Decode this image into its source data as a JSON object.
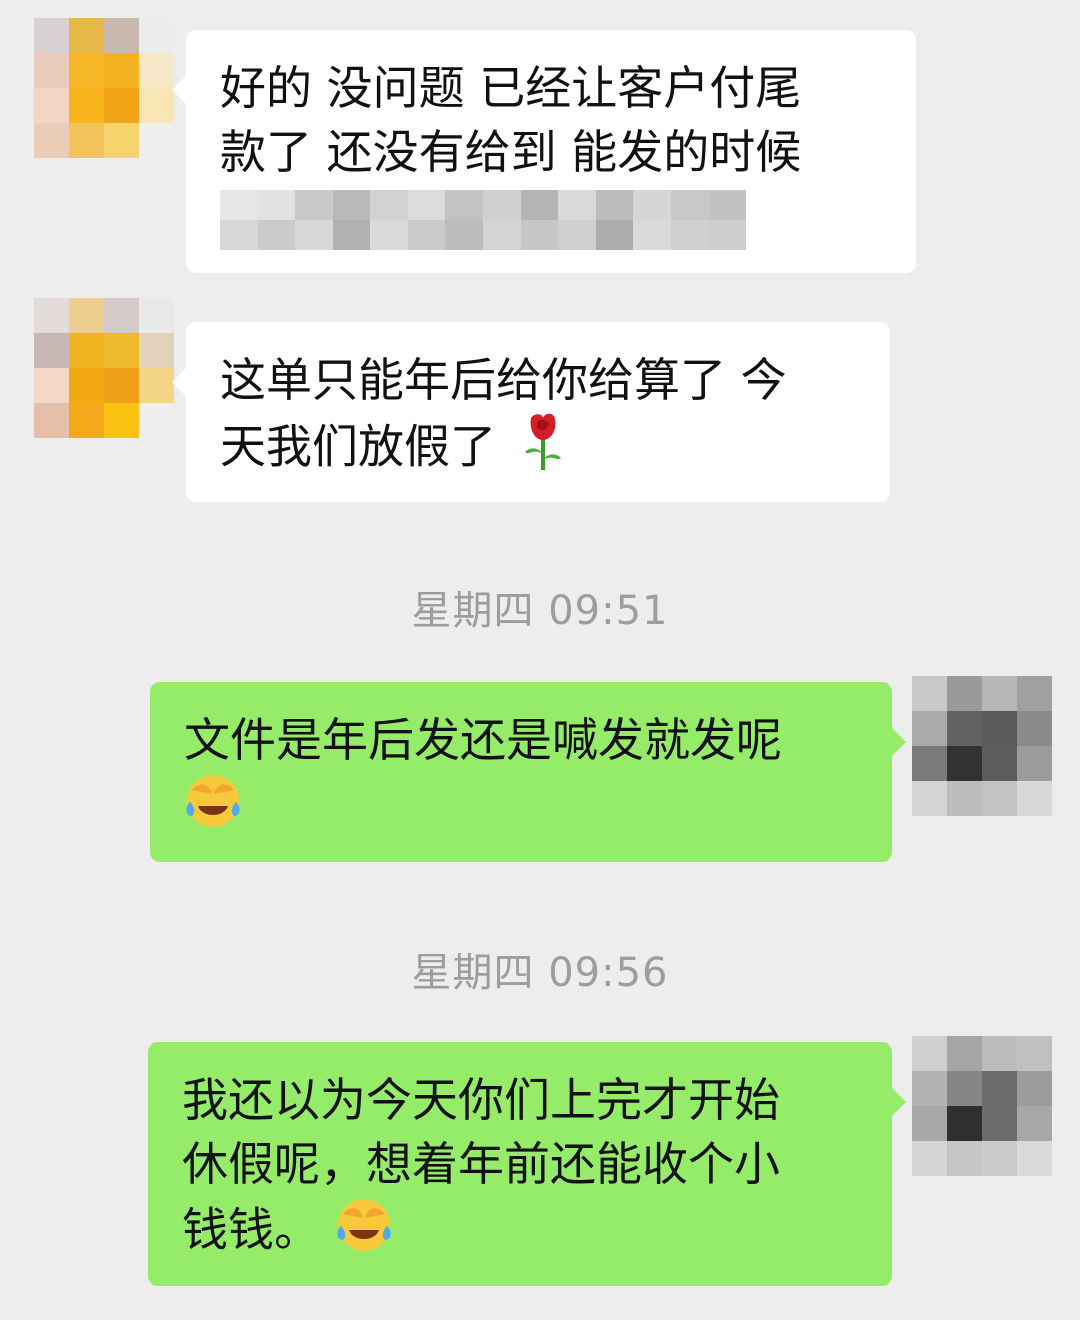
{
  "messages": [
    {
      "side": "in",
      "lines": [
        "好的 没问题  已经让客户付尾",
        "款了 还没有给到 能发的时候"
      ],
      "has_redacted_line": true
    },
    {
      "side": "in",
      "lines": [
        "这单只能年后给你给算了 今",
        "天我们放假了"
      ],
      "emoji": "rose-icon"
    },
    {
      "side": "out",
      "lines": [
        "文件是年后发还是喊发就发呢"
      ],
      "emoji": "face-palm-crying-icon"
    },
    {
      "side": "out",
      "lines": [
        "我还以为今天你们上完才开始",
        "休假呢，想着年前还能收个小",
        "钱钱。"
      ],
      "emoji": "face-palm-crying-icon"
    }
  ],
  "timestamps": [
    "星期四 09:51",
    "星期四 09:56"
  ],
  "colors": {
    "background": "#ededed",
    "incoming_bubble": "#ffffff",
    "outgoing_bubble": "#95ec69",
    "timestamp_text": "#9d9d9d"
  }
}
